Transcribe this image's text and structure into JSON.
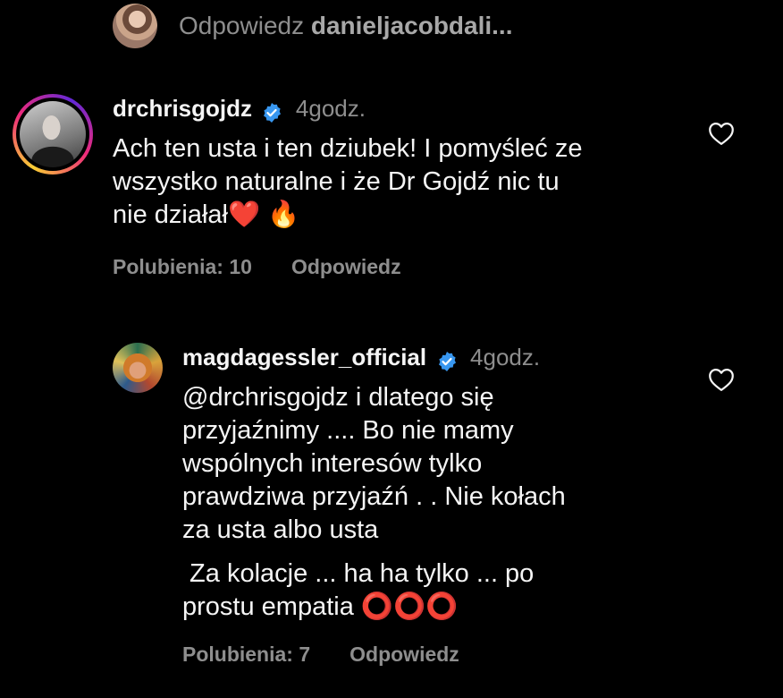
{
  "reply_prompt": {
    "prefix": "Odpowiedz",
    "username": "danieljacobdali..."
  },
  "comments": [
    {
      "username": "drchrisgojdz",
      "verified": true,
      "time": "4godz.",
      "lines": [
        "Ach ten usta i ten dziubek! I pomyśleć ze",
        "wszystko naturalne i że  Dr Gojdź nic tu",
        "nie działał❤️ 🔥"
      ],
      "likes": "Polubienia: 10",
      "reply": "Odpowiedz"
    },
    {
      "username": "magdagessler_official",
      "verified": true,
      "time": "4godz.",
      "lines": [
        "@drchrisgojdz i dlatego się",
        "przyjaźnimy .... Bo nie mamy",
        "wspólnych interesów tylko",
        "prawdziwa przyjaźń . .  Nie kołach",
        "za usta albo usta"
      ],
      "lines2": [
        " Za kolacje ... ha ha tylko ... po",
        "prostu empatia ⭕⭕⭕"
      ],
      "likes": "Polubienia: 7",
      "reply": "Odpowiedz"
    }
  ],
  "icons": {
    "verified": "verified-badge-icon",
    "like": "heart-outline-icon"
  },
  "colors": {
    "background": "#000000",
    "text": "#f5f5f5",
    "muted": "#8e8e8e",
    "verified": "#3897f0"
  }
}
